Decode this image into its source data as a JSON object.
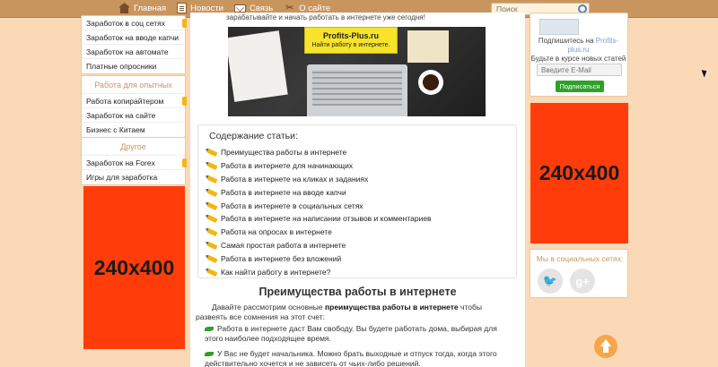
{
  "nav": {
    "items": [
      {
        "label": "Главная",
        "icon": "home-icon"
      },
      {
        "label": "Новости",
        "icon": "news-icon"
      },
      {
        "label": "Связь",
        "icon": "mail-icon"
      },
      {
        "label": "О сайте",
        "icon": "tools-icon"
      }
    ],
    "search_placeholder": "Поиск"
  },
  "left": {
    "group1": {
      "items": [
        "Заработок в соц сетях",
        "Заработок на вводе капчи",
        "Заработок на автомате",
        "Платные опросники"
      ]
    },
    "group2": {
      "title": "Работа для опытных",
      "items": [
        "Работа копирайтером",
        "Заработок на сайте",
        "Бизнес с Китаем"
      ]
    },
    "group3": {
      "title": "Другое",
      "items": [
        "Заработок на Forex",
        "Игры для заработка"
      ]
    },
    "ad_label": "240x400"
  },
  "main": {
    "intro": "зарабатывайте и начать работать в интернете уже сегодня!",
    "hero": {
      "site": "Profits-Plus.ru",
      "tagline": "Найти работу в интернете."
    },
    "toc": {
      "title": "Содержание статьи:",
      "items": [
        "Преимущества работы в интернете",
        "Работа в интернете для начинающих",
        "Работа в интернете на кликах и заданиях",
        "Работа в интернете на вводе капчи",
        "Работа в интернете в социальных сетях",
        "Работа в интернете на написании отзывов и комментариев",
        "Работа на опросах в интернете",
        "Самая простая работа в интернете",
        "Работа в интернете без вложений",
        "Как найти работу в интернете?"
      ]
    },
    "heading": "Преимущества работы в интернете",
    "para1_a": "Давайте рассмотрим основные ",
    "para1_b": "преимущества работы в интернете",
    "para1_c": " чтобы развеять все сомнения на этот счет:",
    "bullet1": "Работа в интернете даст Вам свободу. Вы будете работать дома, выбирая для этого наиболее подходящее время.",
    "bullet2": "У Вас не будет начальника. Можно брать выходные и отпуск тогда, когда этого действительно хочется и не зависеть от чьих-либо решений."
  },
  "right": {
    "subscribe_line1": "Подпишитесь на ",
    "subscribe_brand": "Profits-plus.ru",
    "subscribe_line2": "Будьте в курсе новых статей и интересных новостей!",
    "email_placeholder": "Введите E-Mail",
    "subscribe_button": "Подписаться",
    "ad_label": "240x400",
    "social_title": "Мы в социальных сетях:",
    "social": [
      {
        "icon": "twitter-icon",
        "glyph": "🐦"
      },
      {
        "icon": "google-plus-icon",
        "glyph": "g+"
      }
    ]
  },
  "colors": {
    "accent": "#c9955f",
    "ad": "#ff3c0a",
    "green": "#2fa12a",
    "background": "#fbd9b6"
  }
}
